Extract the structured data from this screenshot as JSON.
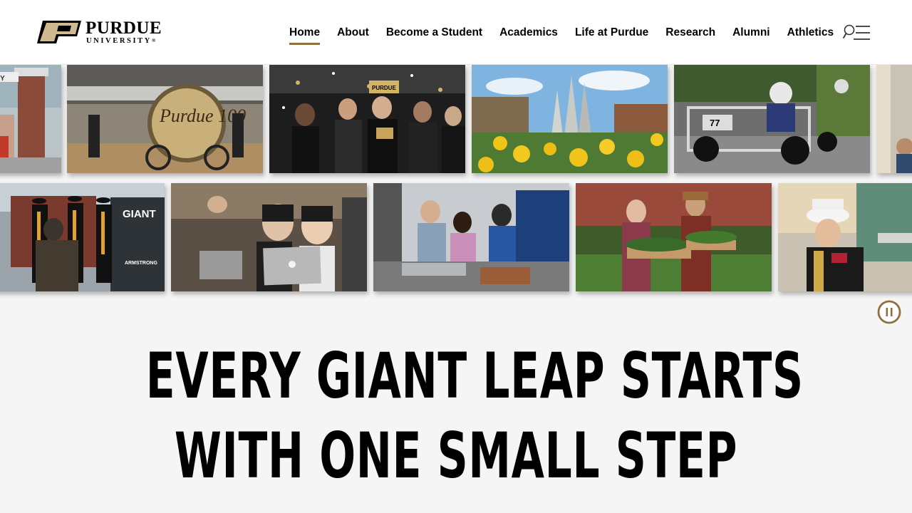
{
  "header": {
    "logo": {
      "wordmark": "PURDUE",
      "subtitle": "UNIVERSITY",
      "registered": "®",
      "mark_letter": "P"
    },
    "nav": [
      {
        "label": "Home",
        "active": true
      },
      {
        "label": "About",
        "active": false
      },
      {
        "label": "Become a Student",
        "active": false
      },
      {
        "label": "Academics",
        "active": false
      },
      {
        "label": "Life at Purdue",
        "active": false
      },
      {
        "label": "Research",
        "active": false
      },
      {
        "label": "Alumni",
        "active": false
      },
      {
        "label": "Athletics",
        "active": false
      }
    ],
    "search_menu_icon": "search-menu-icon"
  },
  "mosaic": {
    "row1": [
      {
        "name": "photo-student-gate",
        "sign": "TY"
      },
      {
        "name": "photo-drum-celebration",
        "sign": "Purdue 100"
      },
      {
        "name": "photo-championship-celebration",
        "sign": "PURDUE"
      },
      {
        "name": "photo-fountain-pansies"
      },
      {
        "name": "photo-grand-prix-kart",
        "sign": "77"
      },
      {
        "name": "photo-partial-edge"
      }
    ],
    "row2": [
      {
        "name": "photo-graduates-statue",
        "sign": "GIANT",
        "sign2": "ARMSTRONG"
      },
      {
        "name": "photo-students-laptops"
      },
      {
        "name": "photo-lab-workshop"
      },
      {
        "name": "photo-students-plants"
      },
      {
        "name": "photo-marching-band"
      }
    ]
  },
  "pause_icon": "pause-icon",
  "hero": {
    "line1": "EVERY GIANT LEAP STARTS",
    "line2": "WITH ONE SMALL STEP"
  },
  "colors": {
    "gold": "#8e6f3e",
    "logo_gold": "#cfb991",
    "text": "#000000",
    "page_bg": "#f5f5f5"
  }
}
